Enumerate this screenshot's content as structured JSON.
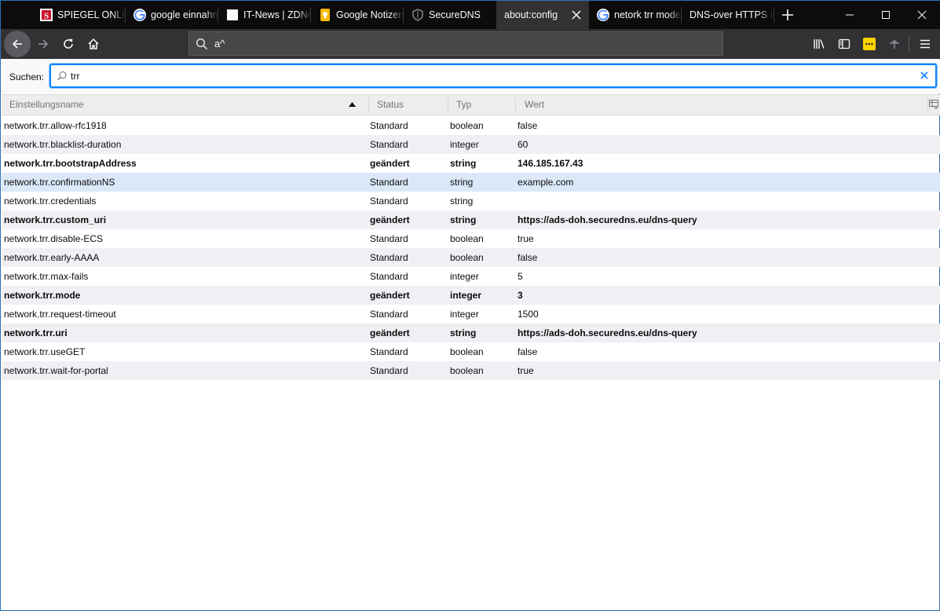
{
  "tabs": [
    {
      "label": "SPIEGEL ONLINE",
      "icon": "spiegel-icon"
    },
    {
      "label": "google einnahmen",
      "icon": "google-icon"
    },
    {
      "label": "IT-News | ZDNet",
      "icon": "blank-page-icon"
    },
    {
      "label": "Google Notizen",
      "icon": "keep-icon"
    },
    {
      "label": "SecureDNS",
      "icon": "shield-icon"
    },
    {
      "label": "about:config",
      "icon": "none",
      "active": true
    },
    {
      "label": "netork trr mode",
      "icon": "google-icon"
    },
    {
      "label": "DNS-over HTTPS Info",
      "icon": "none"
    }
  ],
  "urlbar": {
    "value": "a^"
  },
  "search": {
    "label": "Suchen:",
    "value": "trr"
  },
  "table": {
    "columns": [
      "Einstellungsname",
      "Status",
      "Typ",
      "Wert"
    ],
    "rows": [
      {
        "name": "network.trr.allow-rfc1918",
        "status": "Standard",
        "type": "boolean",
        "value": "false",
        "modified": false
      },
      {
        "name": "network.trr.blacklist-duration",
        "status": "Standard",
        "type": "integer",
        "value": "60",
        "modified": false
      },
      {
        "name": "network.trr.bootstrapAddress",
        "status": "geändert",
        "type": "string",
        "value": "146.185.167.43",
        "modified": true
      },
      {
        "name": "network.trr.confirmationNS",
        "status": "Standard",
        "type": "string",
        "value": "example.com",
        "modified": false,
        "selected": true
      },
      {
        "name": "network.trr.credentials",
        "status": "Standard",
        "type": "string",
        "value": "",
        "modified": false
      },
      {
        "name": "network.trr.custom_uri",
        "status": "geändert",
        "type": "string",
        "value": "https://ads-doh.securedns.eu/dns-query",
        "modified": true
      },
      {
        "name": "network.trr.disable-ECS",
        "status": "Standard",
        "type": "boolean",
        "value": "true",
        "modified": false
      },
      {
        "name": "network.trr.early-AAAA",
        "status": "Standard",
        "type": "boolean",
        "value": "false",
        "modified": false
      },
      {
        "name": "network.trr.max-fails",
        "status": "Standard",
        "type": "integer",
        "value": "5",
        "modified": false
      },
      {
        "name": "network.trr.mode",
        "status": "geändert",
        "type": "integer",
        "value": "3",
        "modified": true
      },
      {
        "name": "network.trr.request-timeout",
        "status": "Standard",
        "type": "integer",
        "value": "1500",
        "modified": false
      },
      {
        "name": "network.trr.uri",
        "status": "geändert",
        "type": "string",
        "value": "https://ads-doh.securedns.eu/dns-query",
        "modified": true
      },
      {
        "name": "network.trr.useGET",
        "status": "Standard",
        "type": "boolean",
        "value": "false",
        "modified": false
      },
      {
        "name": "network.trr.wait-for-portal",
        "status": "Standard",
        "type": "boolean",
        "value": "true",
        "modified": false
      }
    ]
  },
  "colors": {
    "accent": "#0a84ff",
    "tabstrip": "#0c0c0d",
    "toolbar": "#323234",
    "selected_row": "#dbe8f8",
    "library_badge": "#ffe900"
  }
}
